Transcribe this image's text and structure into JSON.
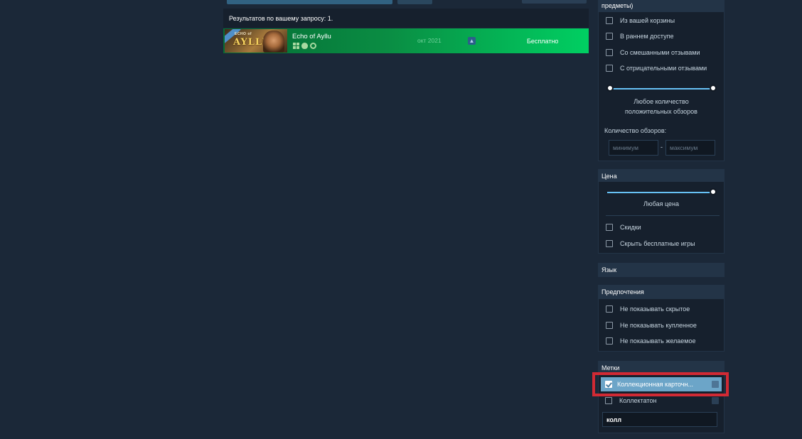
{
  "search": {
    "results_summary": "Результатов по вашему запросу: 1."
  },
  "results": [
    {
      "title": "Echo of Ayllu",
      "capsule_logo_top": "ECHO of",
      "capsule_logo_main": "AYLLU",
      "platforms": [
        "windows-icon",
        "apple-icon",
        "steam-icon"
      ],
      "release_date": "окт 2021",
      "deck_badge": "steam-deck-icon",
      "price": "Бесплатно"
    }
  ],
  "filters": {
    "top_panel": {
      "title_fragment": "предметы)",
      "checks": [
        {
          "label": "Из вашей корзины",
          "checked": false
        },
        {
          "label": "В раннем доступе",
          "checked": false
        },
        {
          "label": "Со смешанными отзывами",
          "checked": false
        },
        {
          "label": "С отрицательными отзывами",
          "checked": false
        }
      ],
      "review_slider_line1": "Любое количество",
      "review_slider_line2": "положительных обзоров",
      "review_count_label": "Количество обзоров:",
      "min_placeholder": "минимум",
      "range_sep": "-",
      "max_placeholder": "максимум"
    },
    "price": {
      "title": "Цена",
      "slider_label": "Любая цена",
      "checks": [
        {
          "label": "Скидки",
          "checked": false
        },
        {
          "label": "Скрыть бесплатные игры",
          "checked": false
        }
      ]
    },
    "language": {
      "title": "Язык"
    },
    "preferences": {
      "title": "Предпочтения",
      "checks": [
        {
          "label": "Не показывать скрытое",
          "checked": false
        },
        {
          "label": "Не показывать купленное",
          "checked": false
        },
        {
          "label": "Не показывать желаемое",
          "checked": false
        }
      ]
    },
    "tags": {
      "title": "Метки",
      "checks": [
        {
          "label": "Коллекционная карточн...",
          "checked": true
        },
        {
          "label": "Коллектатон",
          "checked": false
        }
      ],
      "search_value": "колл"
    }
  },
  "colors": {
    "background": "#1b2838",
    "accent": "#67c1f5",
    "highlight": "#d12a34",
    "result_row_green": "#00cf62"
  }
}
